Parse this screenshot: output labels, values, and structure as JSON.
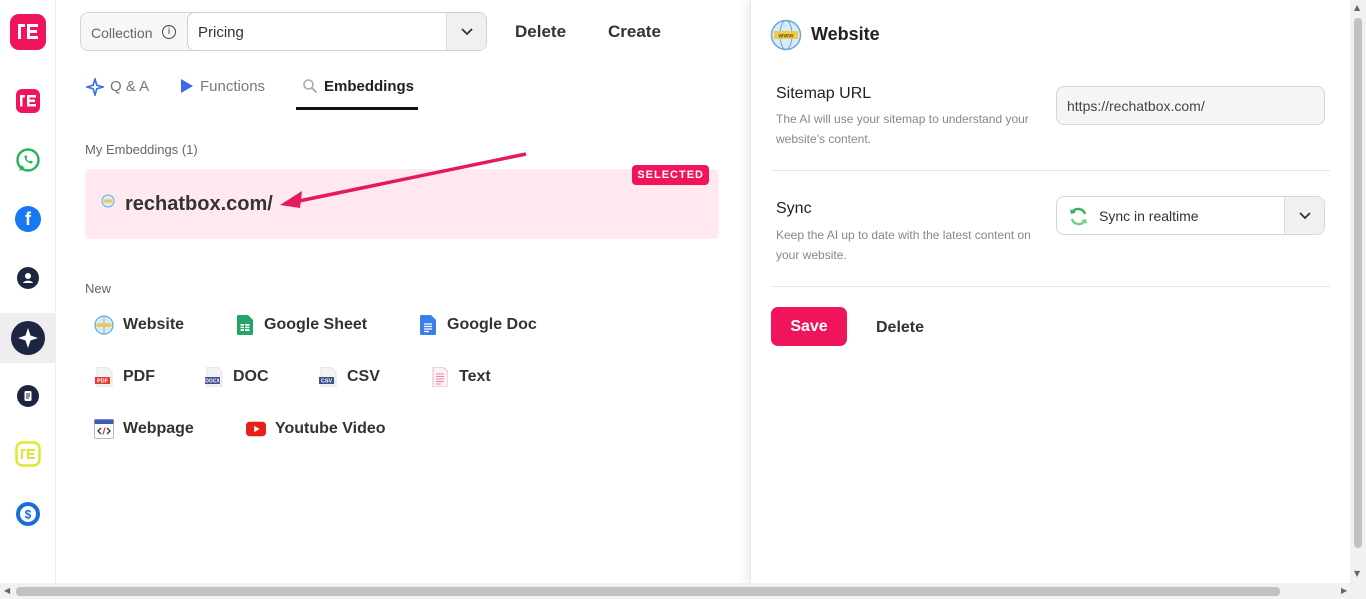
{
  "collection": {
    "label": "Collection",
    "selected": "Pricing"
  },
  "toolbar": {
    "delete_label": "Delete",
    "create_label": "Create"
  },
  "tabs": [
    {
      "label": "Q & A",
      "icon": "sparkle-icon"
    },
    {
      "label": "Functions",
      "icon": "play-icon"
    },
    {
      "label": "Embeddings",
      "icon": "search-icon",
      "active": true
    }
  ],
  "embeddings": {
    "section_label": "My Embeddings (1)",
    "items": [
      {
        "name": "rechatbox.com/",
        "badge": "SELECTED",
        "icon": "globe-icon"
      }
    ]
  },
  "new_section": {
    "label": "New",
    "items": [
      {
        "label": "Website",
        "icon": "globe-icon"
      },
      {
        "label": "Google Sheet",
        "icon": "google-sheet-icon"
      },
      {
        "label": "Google Doc",
        "icon": "google-doc-icon"
      },
      {
        "label": "PDF",
        "icon": "pdf-file-icon"
      },
      {
        "label": "DOC",
        "icon": "docx-file-icon"
      },
      {
        "label": "CSV",
        "icon": "csv-file-icon"
      },
      {
        "label": "Text",
        "icon": "text-file-icon"
      },
      {
        "label": "Webpage",
        "icon": "code-page-icon"
      },
      {
        "label": "Youtube Video",
        "icon": "youtube-icon"
      }
    ]
  },
  "panel": {
    "title": "Website",
    "sitemap": {
      "title": "Sitemap URL",
      "description": "The AI will use your sitemap to understand your website's content.",
      "value": "https://rechatbox.com/"
    },
    "sync": {
      "title": "Sync",
      "description": "Keep the AI up to date with the latest content on your website.",
      "value": "Sync in realtime"
    },
    "save_label": "Save",
    "delete_label": "Delete"
  },
  "colors": {
    "brand": "#f0145a",
    "selected_bg": "#ffe9ef"
  }
}
